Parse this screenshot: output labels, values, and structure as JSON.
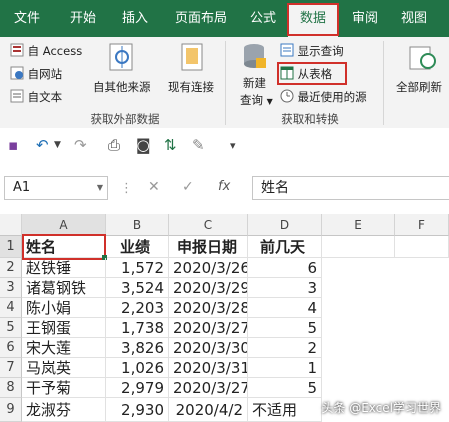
{
  "tabs": [
    "文件",
    "开始",
    "插入",
    "页面布局",
    "公式",
    "数据",
    "审阅",
    "视图"
  ],
  "ribbon": {
    "external": {
      "access": "自 Access",
      "website": "自网站",
      "text": "自文本",
      "other_sources": "自其他来源",
      "existing_connections": "现有连接",
      "group_label": "获取外部数据"
    },
    "transform": {
      "new_query_1": "新建",
      "new_query_2": "查询",
      "show_queries": "显示查询",
      "from_table": "从表格",
      "recent_sources": "最近使用的源",
      "group_label": "获取和转换"
    },
    "refresh_all": "全部刷新"
  },
  "formula_bar": {
    "name_box": "A1",
    "fx": "fx",
    "cancel": "✕",
    "confirm": "✓",
    "content": "姓名"
  },
  "sheet": {
    "columns": [
      "A",
      "B",
      "C",
      "D",
      "E",
      "F"
    ],
    "row_numbers": [
      "1",
      "2",
      "3",
      "4",
      "5",
      "6",
      "7",
      "8",
      "9"
    ],
    "rows": [
      [
        "姓名",
        "业绩",
        "申报日期",
        "前几天"
      ],
      [
        "赵铁锤",
        "1,572",
        "2020/3/26",
        "6"
      ],
      [
        "诸葛钢铁",
        "3,524",
        "2020/3/29",
        "3"
      ],
      [
        "陈小娟",
        "2,203",
        "2020/3/28",
        "4"
      ],
      [
        "王钢蛋",
        "1,738",
        "2020/3/27",
        "5"
      ],
      [
        "宋大莲",
        "3,826",
        "2020/3/30",
        "2"
      ],
      [
        "马岚英",
        "1,026",
        "2020/3/31",
        "1"
      ],
      [
        "干予菊",
        "2,979",
        "2020/3/27",
        "5"
      ],
      [
        "龙淑芬",
        "2,930",
        "2020/4/2",
        "不适用"
      ]
    ]
  },
  "watermark": "头条 @Excel学习世界",
  "colors": {
    "excel_green": "#217346",
    "highlight_red": "#d0302a"
  }
}
